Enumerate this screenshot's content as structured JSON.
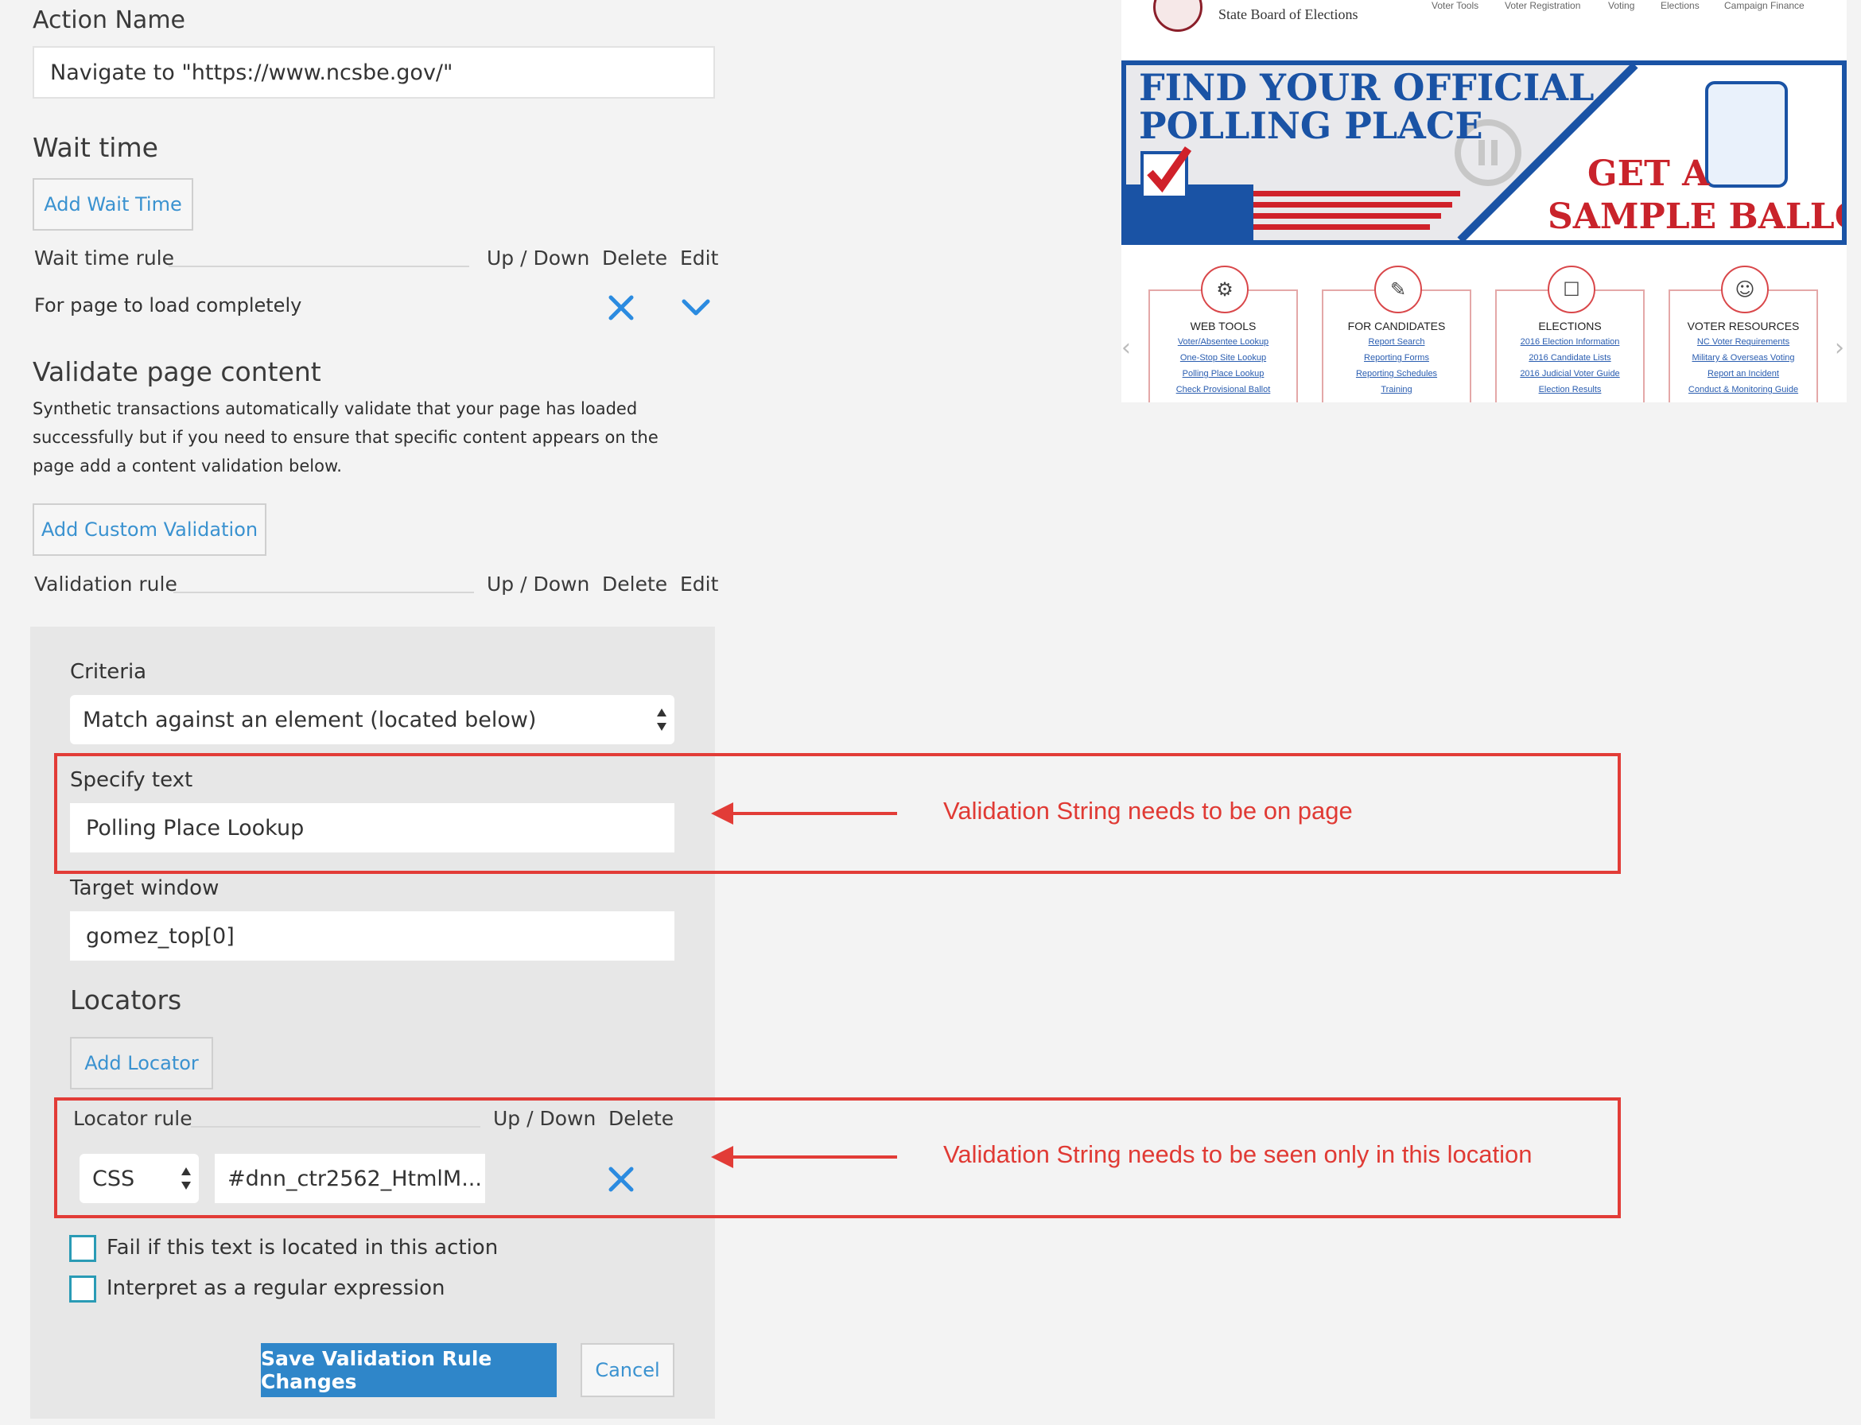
{
  "form": {
    "action_name_label": "Action Name",
    "action_name_value": "Navigate to \"https://www.ncsbe.gov/\"",
    "wait_time_title": "Wait time",
    "add_wait_time_button": "Add Wait Time",
    "wait_table": {
      "col_rule": "Wait time rule",
      "col_updown": "Up / Down",
      "col_delete": "Delete",
      "col_edit": "Edit",
      "row_text": "For page to load completely"
    },
    "validate_title": "Validate page content",
    "validate_desc_1": "Synthetic transactions automatically validate that your page has loaded",
    "validate_desc_2": "successfully but if you need to ensure that specific content appears on the",
    "validate_desc_3": "page add a content validation below.",
    "add_custom_validation_button": "Add Custom Validation",
    "validation_table": {
      "col_rule": "Validation rule",
      "col_updown": "Up / Down",
      "col_delete": "Delete",
      "col_edit": "Edit"
    }
  },
  "editor": {
    "criteria_label": "Criteria",
    "criteria_value": "Match against an element (located below)",
    "specify_text_label": "Specify text",
    "specify_text_value": "Polling Place Lookup",
    "target_window_label": "Target window",
    "target_window_value": "gomez_top[0]",
    "locators_title": "Locators",
    "add_locator_button": "Add Locator",
    "locator_table": {
      "col_rule": "Locator rule",
      "col_updown": "Up / Down",
      "col_delete": "Delete",
      "type_value": "CSS",
      "selector_value": "#dnn_ctr2562_HtmlM..."
    },
    "checkbox_fail": "Fail if this text is located in this action",
    "checkbox_regex": "Interpret as a regular expression",
    "save_button": "Save Validation Rule Changes",
    "cancel_button": "Cancel"
  },
  "annotations": {
    "note_1": "Validation String needs to be on page",
    "note_2": "Validation String needs to be seen only in this location",
    "color": "#e23c37"
  },
  "preview": {
    "site_subtitle": "State Board of Elections",
    "nav": [
      "Voter Tools",
      "Voter Registration",
      "Voting",
      "Elections",
      "Campaign Finance"
    ],
    "banner_line_1": "FIND YOUR OFFICIAL",
    "banner_line_2": "POLLING PLACE",
    "banner_line_3": "GET A",
    "banner_line_4": "SAMPLE BALLOT",
    "cards": [
      {
        "title": "WEB TOOLS",
        "links": [
          "Voter/Absentee Lookup",
          "One-Stop Site Lookup",
          "Polling Place Lookup",
          "Check Provisional Ballot"
        ]
      },
      {
        "title": "FOR CANDIDATES",
        "links": [
          "Report Search",
          "Reporting Forms",
          "Reporting Schedules",
          "Training"
        ]
      },
      {
        "title": "ELECTIONS",
        "links": [
          "2016 Election Information",
          "2016 Candidate Lists",
          "2016 Judicial Voter Guide",
          "Election Results"
        ]
      },
      {
        "title": "VOTER RESOURCES",
        "links": [
          "NC Voter Requirements",
          "Military & Overseas Voting",
          "Report an Incident",
          "Conduct & Monitoring Guide"
        ]
      }
    ]
  },
  "colors": {
    "link_blue": "#3a92d0",
    "icon_blue": "#2b8be0",
    "primary_button": "#2f86c9",
    "checkbox_border": "#2a9bb5"
  }
}
